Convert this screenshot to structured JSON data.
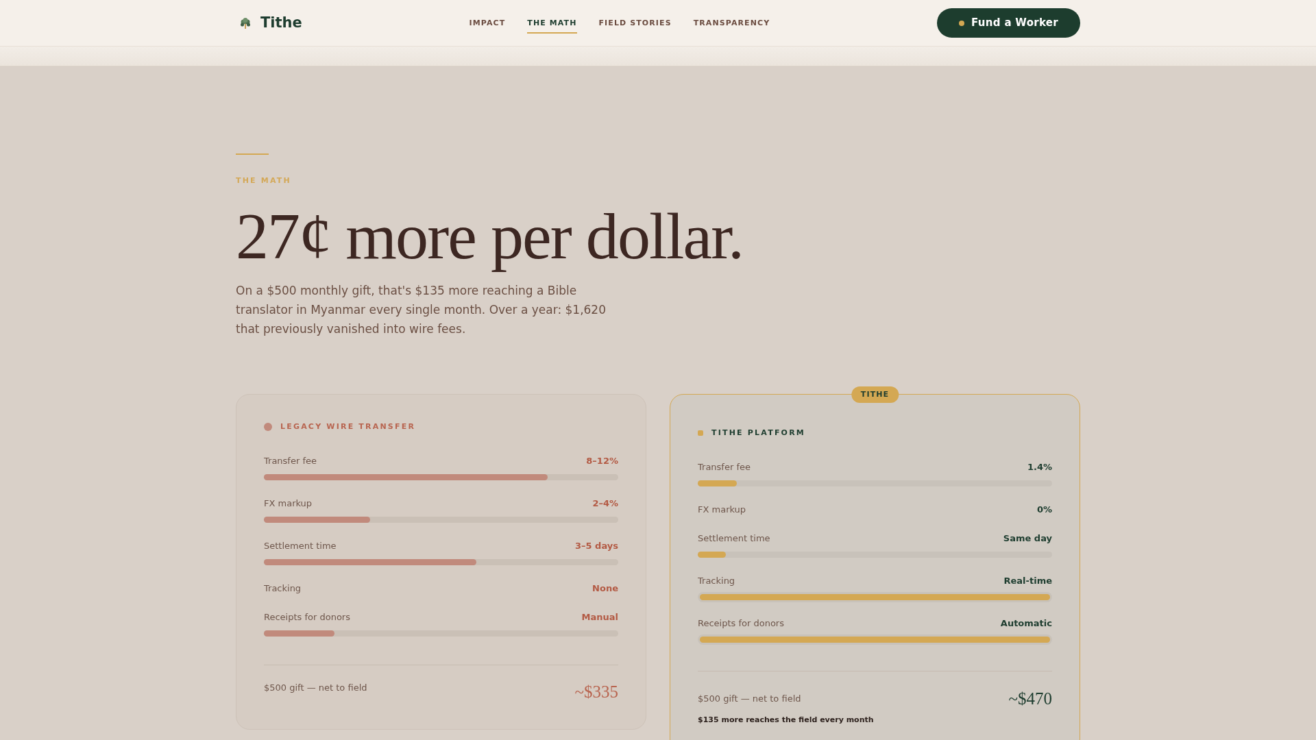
{
  "header": {
    "brand": "Tithe",
    "nav": [
      {
        "label": "IMPACT",
        "selected": false
      },
      {
        "label": "THE MATH",
        "selected": true
      },
      {
        "label": "FIELD STORIES",
        "selected": false
      },
      {
        "label": "TRANSPARENCY",
        "selected": false
      }
    ],
    "cta": "Fund a Worker"
  },
  "hero": {
    "eyebrow": "THE MATH",
    "title": "27¢ more per dollar.",
    "body": "On a $500 monthly gift, that's $135 more reaching a Bible translator in Myanmar every single month. Over a year: $1,620 that previously vanished into wire fees."
  },
  "comparison": [
    {
      "kind": "legacy",
      "color": "#c18a7c",
      "title": "LEGACY WIRE TRANSFER",
      "rows": [
        {
          "kind": "bar",
          "label": "Transfer fee",
          "value": "8–12%",
          "level": 0.8
        },
        {
          "kind": "bar",
          "label": "FX markup",
          "value": "2–4%",
          "level": 0.3
        },
        {
          "kind": "bar",
          "label": "Settlement time",
          "value": "3–5 days",
          "level": 0.6
        },
        {
          "kind": "plain",
          "label": "Tracking",
          "value": "None"
        },
        {
          "kind": "bar",
          "label": "Receipts for donors",
          "value": "Manual",
          "level": 0.2
        }
      ],
      "net_label": "$500 gift — net to field",
      "net_value": "~$335"
    },
    {
      "kind": "featured",
      "badge": "TITHE",
      "color": "#d4a853",
      "title": "TITHE PLATFORM",
      "rows": [
        {
          "kind": "bar",
          "label": "Transfer fee",
          "value": "1.4%",
          "level": 0.11
        },
        {
          "kind": "plain",
          "label": "FX markup",
          "value": "0%"
        },
        {
          "kind": "bar",
          "label": "Settlement time",
          "value": "Same day",
          "level": 0.08
        },
        {
          "kind": "bar",
          "label": "Tracking",
          "value": "Real-time",
          "level": 1
        },
        {
          "kind": "bar",
          "label": "Receipts for donors",
          "value": "Automatic",
          "level": 1
        }
      ],
      "net_label": "$500 gift — net to field",
      "net_value": "~$470",
      "note": "$135 more reaches the field every month"
    }
  ]
}
